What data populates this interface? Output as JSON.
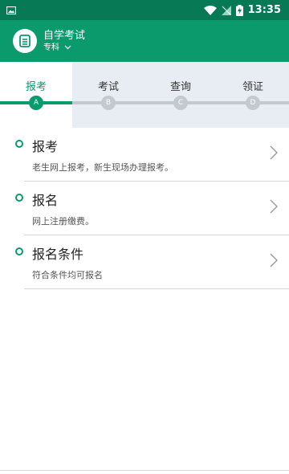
{
  "status_bar": {
    "time": "13:35",
    "icons": [
      "image-icon",
      "wifi-icon",
      "signal-icon",
      "battery-charging-icon"
    ]
  },
  "app": {
    "title": "自学考试",
    "subtitle": "专科",
    "logo_icon": "notebook-icon"
  },
  "steps": [
    {
      "label": "报考",
      "letter": "A",
      "active": true
    },
    {
      "label": "考试",
      "letter": "B",
      "active": false
    },
    {
      "label": "查询",
      "letter": "C",
      "active": false
    },
    {
      "label": "领证",
      "letter": "D",
      "active": false
    }
  ],
  "items": [
    {
      "title": "报考",
      "desc": "老生网上报考，新生现场办理报考。"
    },
    {
      "title": "报名",
      "desc": "网上注册缴费。"
    },
    {
      "title": "报名条件",
      "desc": "符合条件均可报名"
    }
  ],
  "colors": {
    "primary": "#0b9a6b",
    "status_bar": "#077a55",
    "stepper_bg": "#e8edf3",
    "inactive": "#c4c9d0"
  }
}
